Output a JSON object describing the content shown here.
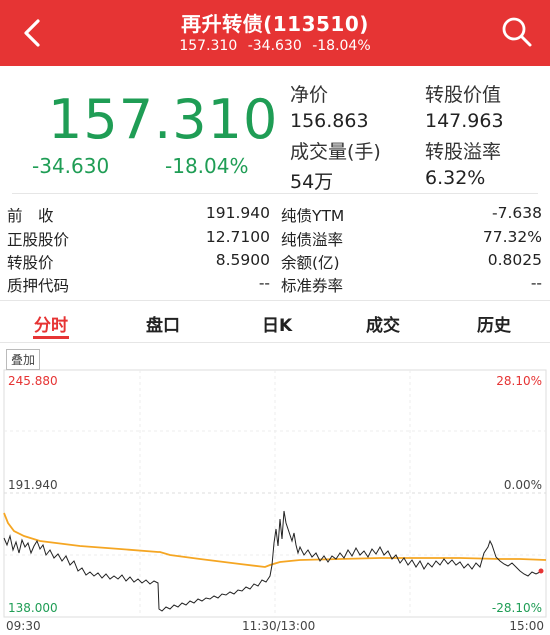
{
  "header": {
    "title": "再升转债(113510)",
    "price": "157.310",
    "change": "-34.630",
    "change_pct": "-18.04%"
  },
  "quote": {
    "price": "157.310",
    "change": "-34.630",
    "change_pct": "-18.04%",
    "net_price_label": "净价",
    "net_price": "156.863",
    "conv_value_label": "转股价值",
    "conv_value": "147.963",
    "volume_label": "成交量(手)",
    "volume": "54万",
    "conv_premium_label": "转股溢率",
    "conv_premium": "6.32%"
  },
  "info": [
    {
      "l1": "前　收",
      "v1": "191.940",
      "l2": "纯债YTM",
      "v2": "-7.638"
    },
    {
      "l1": "正股股价",
      "v1": "12.7100",
      "l2": "纯债溢率",
      "v2": "77.32%"
    },
    {
      "l1": "转股价",
      "v1": "8.5900",
      "l2": "余额(亿)",
      "v2": "0.8025"
    },
    {
      "l1": "质押代码",
      "v1": "--",
      "l2": "标准券率",
      "v2": "--"
    }
  ],
  "tabs": [
    "分时",
    "盘口",
    "日K",
    "成交",
    "历史"
  ],
  "active_tab": "分时",
  "chart": {
    "overlay_label": "叠加",
    "y_high": "245.880",
    "y_mid": "191.940",
    "y_low": "138.000",
    "pct_high": "28.10%",
    "pct_mid": "0.00%",
    "pct_low": "-28.10%",
    "t_start": "09:30",
    "t_mid": "11:30/13:00",
    "t_end": "15:00",
    "colors": {
      "price_line": "#222222",
      "avg_line": "#f5a623",
      "grid": "#e5e5e5",
      "up": "#e63434",
      "down": "#1f9d55"
    }
  },
  "chart_data": {
    "type": "line",
    "ylim": [
      138.0,
      245.88
    ],
    "x_range": [
      "09:30",
      "15:00"
    ],
    "series": []
  }
}
